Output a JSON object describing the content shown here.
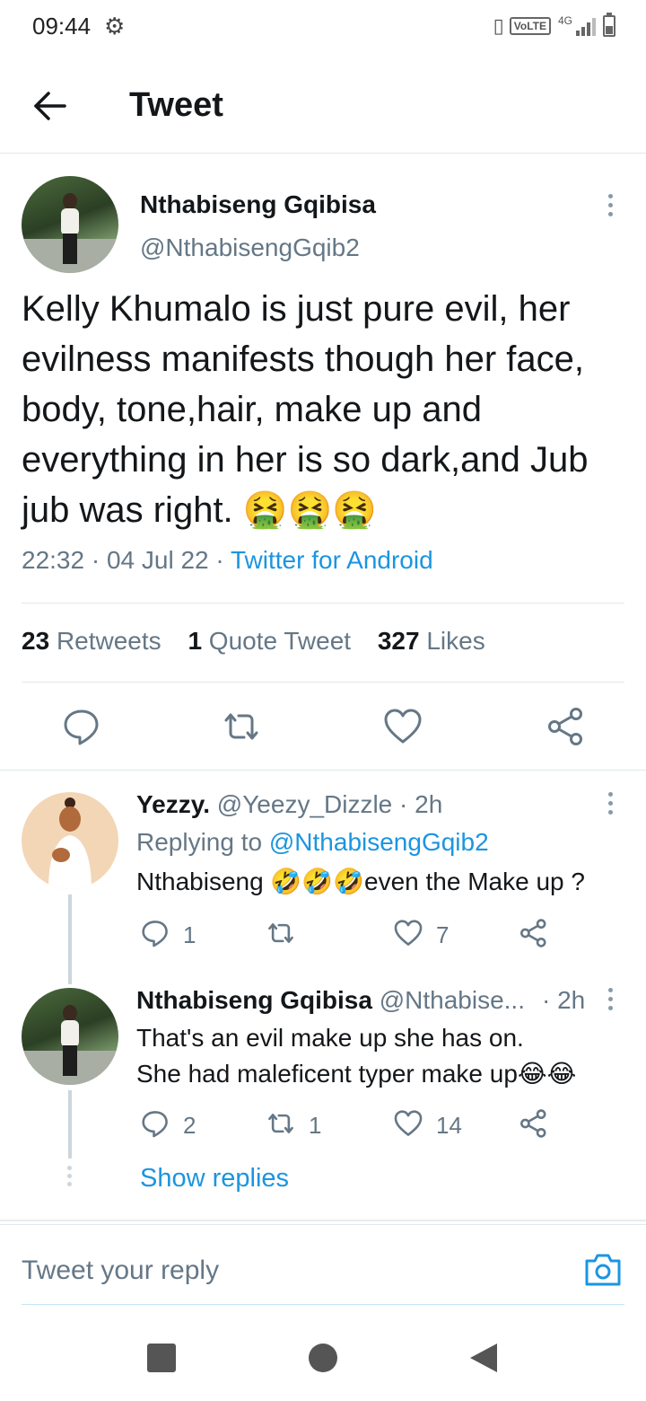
{
  "status_bar": {
    "time": "09:44",
    "network_label": "VoLTE",
    "network_type": "4G",
    "icons": [
      "gear-icon",
      "vibrate-icon",
      "signal-icon",
      "battery-icon"
    ]
  },
  "header": {
    "title": "Tweet",
    "back_icon": "arrow-left-icon"
  },
  "tweet": {
    "author_name": "Nthabiseng Gqibisa",
    "author_handle": "@NthabisengGqib2",
    "text": "Kelly Khumalo is just pure evil, her evilness manifests though her face, body, tone,hair, make up and everything in her is so dark,and Jub jub was right. 🤮🤮🤮",
    "time": "22:32",
    "date": "04 Jul 22",
    "source": "Twitter for Android",
    "retweets_count": "23",
    "retweets_label": "Retweets",
    "quote_count": "1",
    "quote_label": "Quote Tweet",
    "likes_count": "327",
    "likes_label": "Likes"
  },
  "replies": [
    {
      "author_name": "Yezzy.",
      "author_handle": "@Yeezy_Dizzle",
      "time": "· 2h",
      "replying_label": "Replying to",
      "replying_to": "@NthabisengGqib2",
      "text": "Nthabiseng 🤣🤣🤣even the Make up ?",
      "reply_count": "1",
      "retweet_count": "",
      "like_count": "7"
    },
    {
      "author_name": "Nthabiseng Gqibisa",
      "author_handle": "@Nthabise...",
      "time": "· 2h",
      "text_line1": "That's an evil make up  she has on.",
      "text_line2": "She had maleficent typer make up😂😂",
      "reply_count": "2",
      "retweet_count": "1",
      "like_count": "14"
    }
  ],
  "show_replies_label": "Show replies",
  "reply_bar": {
    "placeholder": "Tweet your reply"
  },
  "colors": {
    "accent": "#1b95e0",
    "text": "#14171a",
    "muted": "#657786",
    "divider": "#e1e8ed"
  }
}
